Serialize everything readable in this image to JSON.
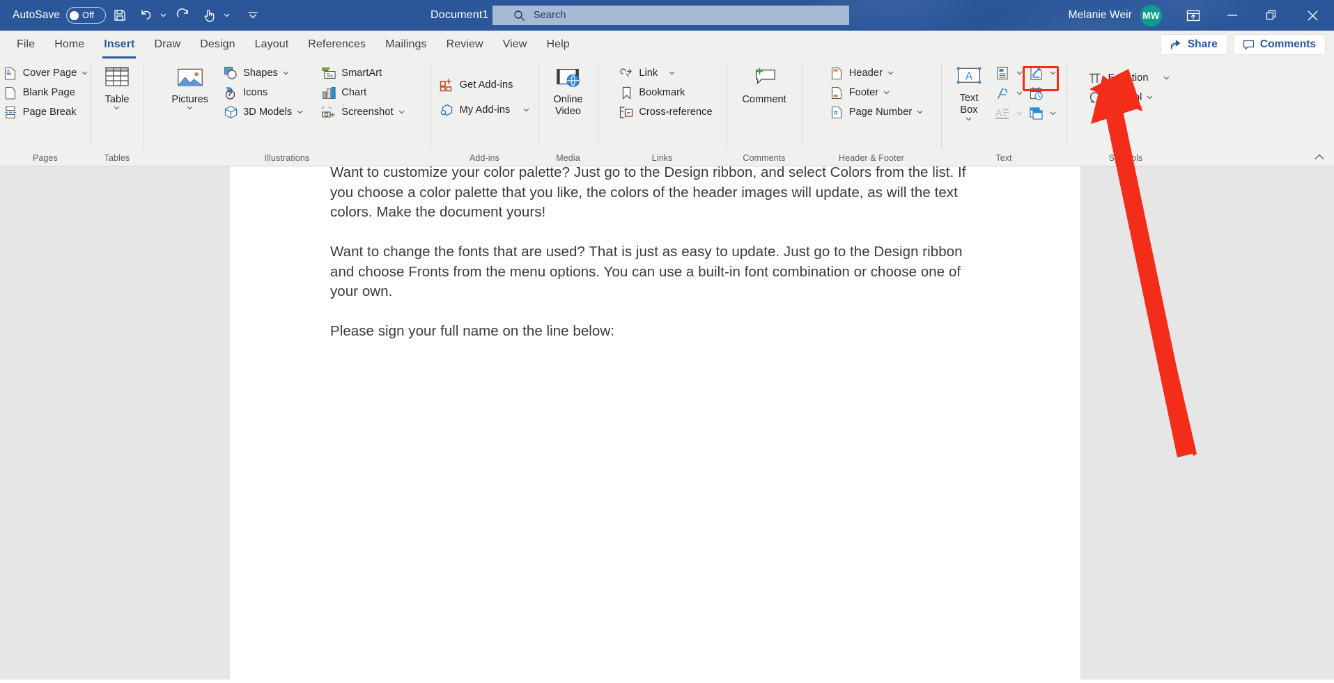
{
  "titlebar": {
    "autosave_label": "AutoSave",
    "autosave_state": "Off",
    "document_title": "Document1  -  Word",
    "search_placeholder": "Search",
    "account_name": "Melanie Weir",
    "account_initials": "MW",
    "icons": {
      "save": "save-icon",
      "undo": "undo-icon",
      "redo": "redo-icon",
      "touch_mode": "touch-mode-icon",
      "customize_qat": "customize-quick-access-toolbar-icon",
      "ribbon_display": "ribbon-display-options-icon",
      "minimize": "minimize-icon",
      "restore": "restore-icon",
      "close": "close-icon"
    },
    "accent_color": "#2b579a",
    "avatar_color": "#0f9b8e"
  },
  "tabs": [
    {
      "label": "File",
      "active": false
    },
    {
      "label": "Home",
      "active": false
    },
    {
      "label": "Insert",
      "active": true
    },
    {
      "label": "Draw",
      "active": false
    },
    {
      "label": "Design",
      "active": false
    },
    {
      "label": "Layout",
      "active": false
    },
    {
      "label": "References",
      "active": false
    },
    {
      "label": "Mailings",
      "active": false
    },
    {
      "label": "Review",
      "active": false
    },
    {
      "label": "View",
      "active": false
    },
    {
      "label": "Help",
      "active": false
    }
  ],
  "tabbar_buttons": {
    "share": "Share",
    "comments": "Comments"
  },
  "ribbon": {
    "groups": [
      {
        "label": "Pages",
        "items": [
          {
            "label": "Cover Page",
            "icon": "cover-page-icon",
            "caret": true
          },
          {
            "label": "Blank Page",
            "icon": "blank-page-icon",
            "caret": false
          },
          {
            "label": "Page Break",
            "icon": "page-break-icon",
            "caret": false
          }
        ]
      },
      {
        "label": "Tables",
        "items": [
          {
            "label": "Table",
            "icon": "table-icon",
            "caret": true
          }
        ]
      },
      {
        "label": "Illustrations",
        "items": [
          {
            "label": "Pictures",
            "icon": "pictures-icon",
            "caret": true
          },
          {
            "label": "Shapes",
            "icon": "shapes-icon",
            "caret": true
          },
          {
            "label": "Icons",
            "icon": "icons-icon",
            "caret": false
          },
          {
            "label": "3D Models",
            "icon": "3d-models-icon",
            "caret": true
          },
          {
            "label": "SmartArt",
            "icon": "smartart-icon",
            "caret": false
          },
          {
            "label": "Chart",
            "icon": "chart-icon",
            "caret": false
          },
          {
            "label": "Screenshot",
            "icon": "screenshot-icon",
            "caret": true
          }
        ]
      },
      {
        "label": "Add-ins",
        "items": [
          {
            "label": "Get Add-ins",
            "icon": "get-add-ins-icon",
            "caret": false
          },
          {
            "label": "My Add-ins",
            "icon": "my-add-ins-icon",
            "caret": true
          }
        ]
      },
      {
        "label": "Media",
        "items": [
          {
            "label": "Online Video",
            "icon": "online-video-icon",
            "caret": false
          }
        ]
      },
      {
        "label": "Links",
        "items": [
          {
            "label": "Link",
            "icon": "link-icon",
            "caret": true
          },
          {
            "label": "Bookmark",
            "icon": "bookmark-icon",
            "caret": false
          },
          {
            "label": "Cross-reference",
            "icon": "cross-reference-icon",
            "caret": false
          }
        ]
      },
      {
        "label": "Comments",
        "items": [
          {
            "label": "Comment",
            "icon": "new-comment-icon",
            "caret": false
          }
        ]
      },
      {
        "label": "Header & Footer",
        "items": [
          {
            "label": "Header",
            "icon": "header-icon",
            "caret": true
          },
          {
            "label": "Footer",
            "icon": "footer-icon",
            "caret": true
          },
          {
            "label": "Page Number",
            "icon": "page-number-icon",
            "caret": true
          }
        ]
      },
      {
        "label": "Text",
        "items": [
          {
            "label": "Text Box",
            "icon": "text-box-icon",
            "caret": true
          },
          {
            "label": "",
            "icon": "explore-quick-parts-icon",
            "caret": true
          },
          {
            "label": "",
            "icon": "wordart-icon",
            "caret": true
          },
          {
            "label": "",
            "icon": "drop-cap-icon",
            "caret": true
          },
          {
            "label": "",
            "icon": "signature-line-icon",
            "caret": true,
            "highlighted": true
          },
          {
            "label": "",
            "icon": "date-and-time-icon",
            "caret": false
          },
          {
            "label": "",
            "icon": "object-icon",
            "caret": true
          }
        ]
      },
      {
        "label": "Symbols",
        "items": [
          {
            "label": "Equation",
            "icon": "equation-icon",
            "caret": true
          },
          {
            "label": "Symbol",
            "icon": "symbol-icon",
            "caret": true
          }
        ]
      }
    ],
    "collapse_icon": "collapse-ribbon-icon",
    "highlight_color": "#f42c1a"
  },
  "document": {
    "paragraphs": [
      "Want to customize your color palette?  Just go to the Design ribbon, and select Colors from the list.  If you choose a color palette that you like, the colors of the header images will update, as will the text colors.  Make the document yours!",
      "Want to change the fonts that are used?  That is just as easy to update.  Just go to the Design ribbon and choose Fronts from the menu options.  You can use a built-in font combination or choose one of your own.",
      "Please sign your full name on the line below:"
    ]
  },
  "annotation": {
    "type": "arrow",
    "color": "#f42c1a",
    "points_to": "signature-line-button"
  }
}
